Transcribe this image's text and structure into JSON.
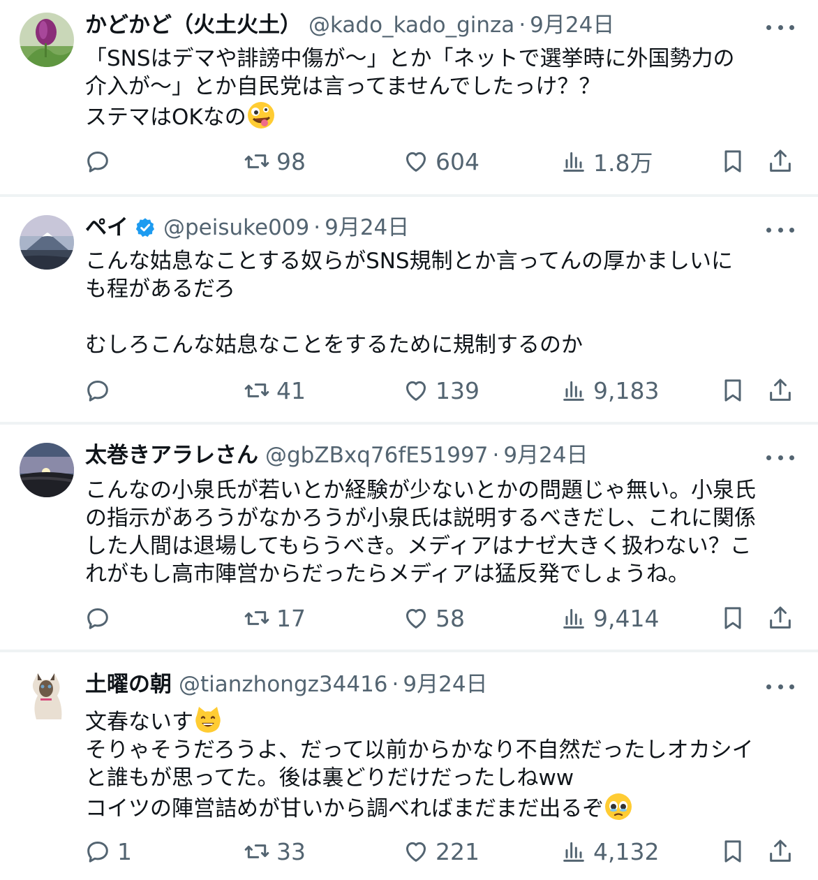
{
  "colors": {
    "text": "#0f1419",
    "muted": "#536471",
    "divider": "#eff3f4",
    "verified": "#1d9bf0"
  },
  "posts": [
    {
      "name": "かどかど（火土火土）",
      "handle": "@kado_kado_ginza",
      "dot": "·",
      "date": "9月24日",
      "verified": false,
      "lines": [
        "「SNSはデマや誹謗中傷が〜」とか「ネットで選挙時に外国勢力の",
        "介入が〜」とか自民党は言ってませんでしたっけ？？",
        "ステマはOKなの"
      ],
      "emoji": "zany-face",
      "replies": "",
      "reposts": "98",
      "likes": "604",
      "views": "1.8万"
    },
    {
      "name": "ペイ",
      "handle": "@peisuke009",
      "dot": "·",
      "date": "9月24日",
      "verified": true,
      "lines": [
        "こんな姑息なことする奴らがSNS規制とか言ってんの厚かましいに",
        "も程があるだろ",
        "",
        "むしろこんな姑息なことをするために規制するのか"
      ],
      "replies": "",
      "reposts": "41",
      "likes": "139",
      "views": "9,183"
    },
    {
      "name": "太巻きアラレさん",
      "handle": "@gbZBxq76fE51997",
      "dot": "·",
      "date": "9月24日",
      "verified": false,
      "lines": [
        "こんなの小泉氏が若いとか経験が少ないとかの問題じゃ無い。小泉氏",
        "の指示があろうがなかろうが小泉氏は説明するべきだし、これに関係",
        "した人間は退場してもらうべき。メディアはナゼ大きく扱わない？こ",
        "れがもし高市陣営からだったらメディアは猛反発でしょうね。"
      ],
      "replies": "",
      "reposts": "17",
      "likes": "58",
      "views": "9,414"
    },
    {
      "name": "土曜の朝",
      "handle": "@tianzhongz34416",
      "dot": "·",
      "date": "9月24日",
      "verified": false,
      "lines": [
        "文春ないす",
        "そりゃそうだろうよ、だって以前からかなり不自然だったしオカシイ",
        "と誰もが思ってた。後は裏どりだけだったしねww",
        "コイツの陣営詰めが甘いから調べればまだまだ出るぞ"
      ],
      "replies": "1",
      "reposts": "33",
      "likes": "221",
      "views": "4,132"
    }
  ]
}
